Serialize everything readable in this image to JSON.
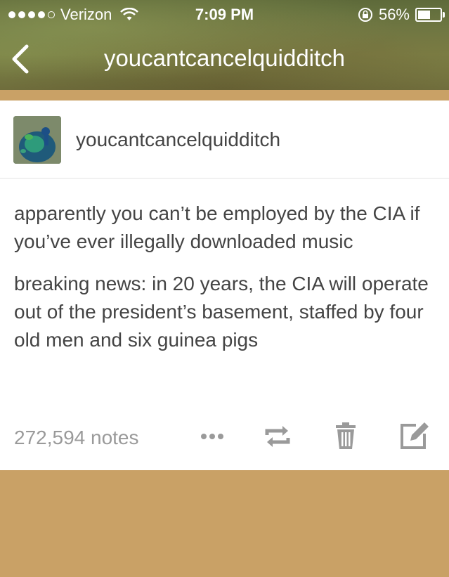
{
  "status_bar": {
    "carrier": "Verizon",
    "time": "7:09 PM",
    "battery": "56%"
  },
  "nav": {
    "title": "youcantcancelquidditch"
  },
  "post": {
    "username": "youcantcancelquidditch",
    "paragraphs": [
      "apparently you can’t be employed by the CIA if you’ve ever illegally downloaded music",
      "breaking news: in 20 years, the CIA will operate out of the president’s basement, staffed by four old men and six guinea pigs"
    ],
    "notes": "272,594 notes"
  },
  "colors": {
    "accent": "#c9a166",
    "text": "#444444",
    "muted": "#9a9a9a"
  },
  "icons": [
    "wifi-icon",
    "lock-rotation-icon",
    "battery-icon",
    "back-chevron-icon",
    "more-icon",
    "reblog-icon",
    "trash-icon",
    "edit-icon"
  ]
}
